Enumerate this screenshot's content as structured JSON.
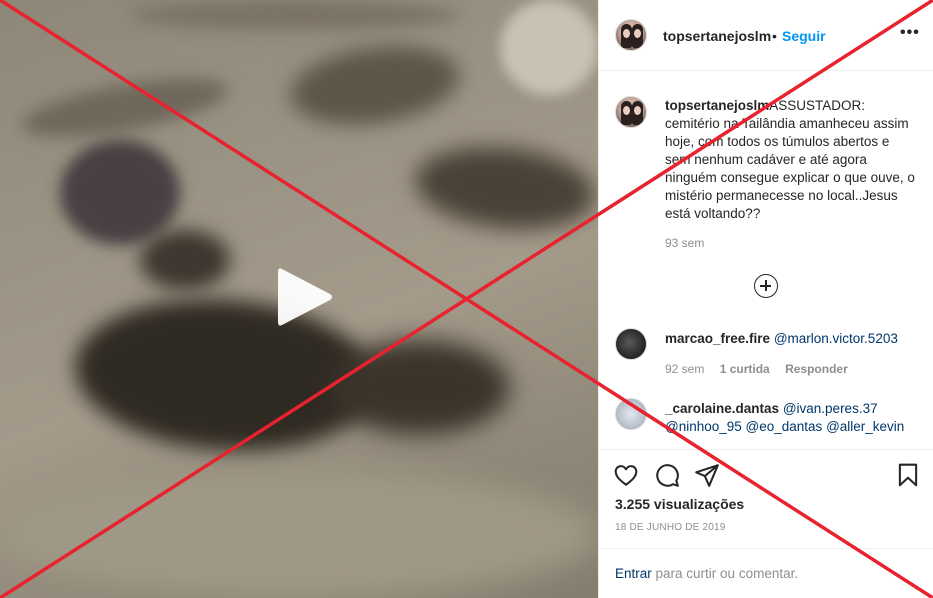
{
  "post": {
    "username": "topsertanejoslm",
    "follow_label": "Seguir",
    "separator": "•",
    "more_label": "•••",
    "caption_user": "topsertanejoslm",
    "caption": "ASSUSTADOR: cemitério na Tailândia amanheceu assim hoje, com todos os túmulos abertos e sem nenhum cadáver e até agora ninguém consegue explicar o que ouve, o mistério permanecesse no local..Jesus está voltando??",
    "caption_time": "93 sem",
    "views": "3.255 visualizações",
    "date": "18 DE JUNHO DE 2019"
  },
  "comments": [
    {
      "user": "marcao_free.fire",
      "text": "@marlon.victor.5203",
      "time": "92 sem",
      "likes": "1 curtida",
      "reply": "Responder"
    },
    {
      "user": "_carolaine.dantas",
      "text_1": "@ivan.peres.37",
      "text_2": "@ninhoo_95",
      "text_3": "@eo_dantas",
      "text_4": "@aller_kevin"
    }
  ],
  "login": {
    "link": "Entrar",
    "text": "para curtir ou comentar."
  },
  "icons": {
    "actions": [
      "heart-icon",
      "comment-icon",
      "share-icon",
      "bookmark-icon"
    ],
    "video": "play-icon",
    "load_more": "plus-circle-icon"
  },
  "colors": {
    "overlay_x": "#e8222e",
    "link_blue": "#0095f6",
    "mention": "#00376b",
    "muted": "#8e8e8e"
  }
}
